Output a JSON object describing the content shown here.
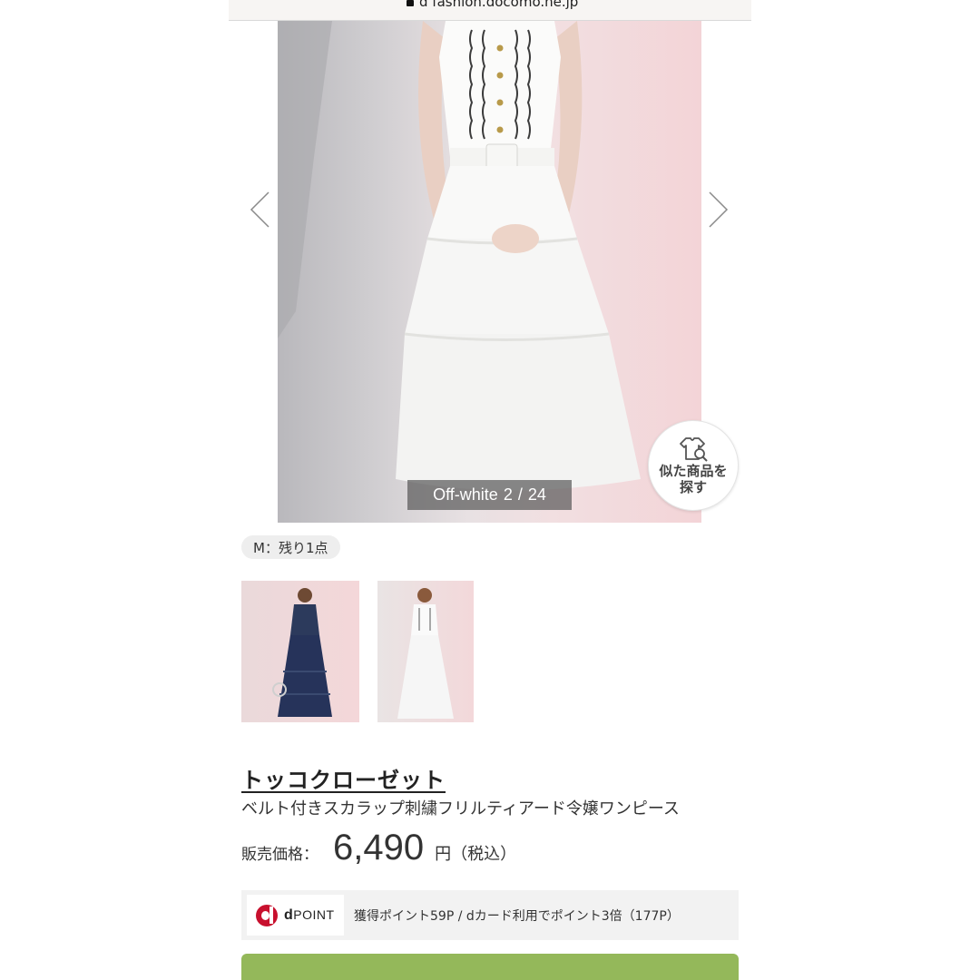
{
  "browser": {
    "url": "d fashion.docomo.ne.jp",
    "lock_icon": "lock-icon"
  },
  "gallery": {
    "counter_color": "Off-white",
    "counter_index": "2",
    "counter_separator": "/",
    "counter_total": "24",
    "prev_icon": "chevron-left-icon",
    "next_icon": "chevron-right-icon",
    "similar_button_label": "似た商品を探す",
    "similar_icon": "shirt-search-icon"
  },
  "stock": {
    "label": "M：残り1点"
  },
  "thumbnails": [
    {
      "name": "navy dress"
    },
    {
      "name": "off-white dress"
    }
  ],
  "product": {
    "brand": "トッコクローゼット",
    "name": "ベルト付きスカラップ刺繍フリルティアード令嬢ワンピース",
    "price_label": "販売価格：",
    "price_value": "6,490",
    "price_unit": "円（税込）"
  },
  "points": {
    "logo_d": "d",
    "logo_text": "POINT",
    "info": "獲得ポイント59P / dカード利用でポイント3倍（177P）"
  },
  "colors": {
    "cart_button": "#94b85a",
    "dpoint_red": "#c8102e"
  }
}
